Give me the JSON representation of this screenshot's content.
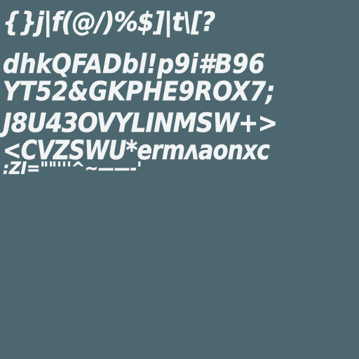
{
  "sheet": {
    "background_color": "#4c6770",
    "glyph_color": "#f2f4f4",
    "rows": [
      "{}j|f(@/)%$]|t\\[?",
      "dhkQFADbl!p9i#B96",
      "YT52&GKPHE9ROX7;",
      "J8U43OVYLINMSW+>",
      "<CVZSWU*ermʌaonxc",
      ":ZI=\"\"'''^~——-'"
    ]
  }
}
